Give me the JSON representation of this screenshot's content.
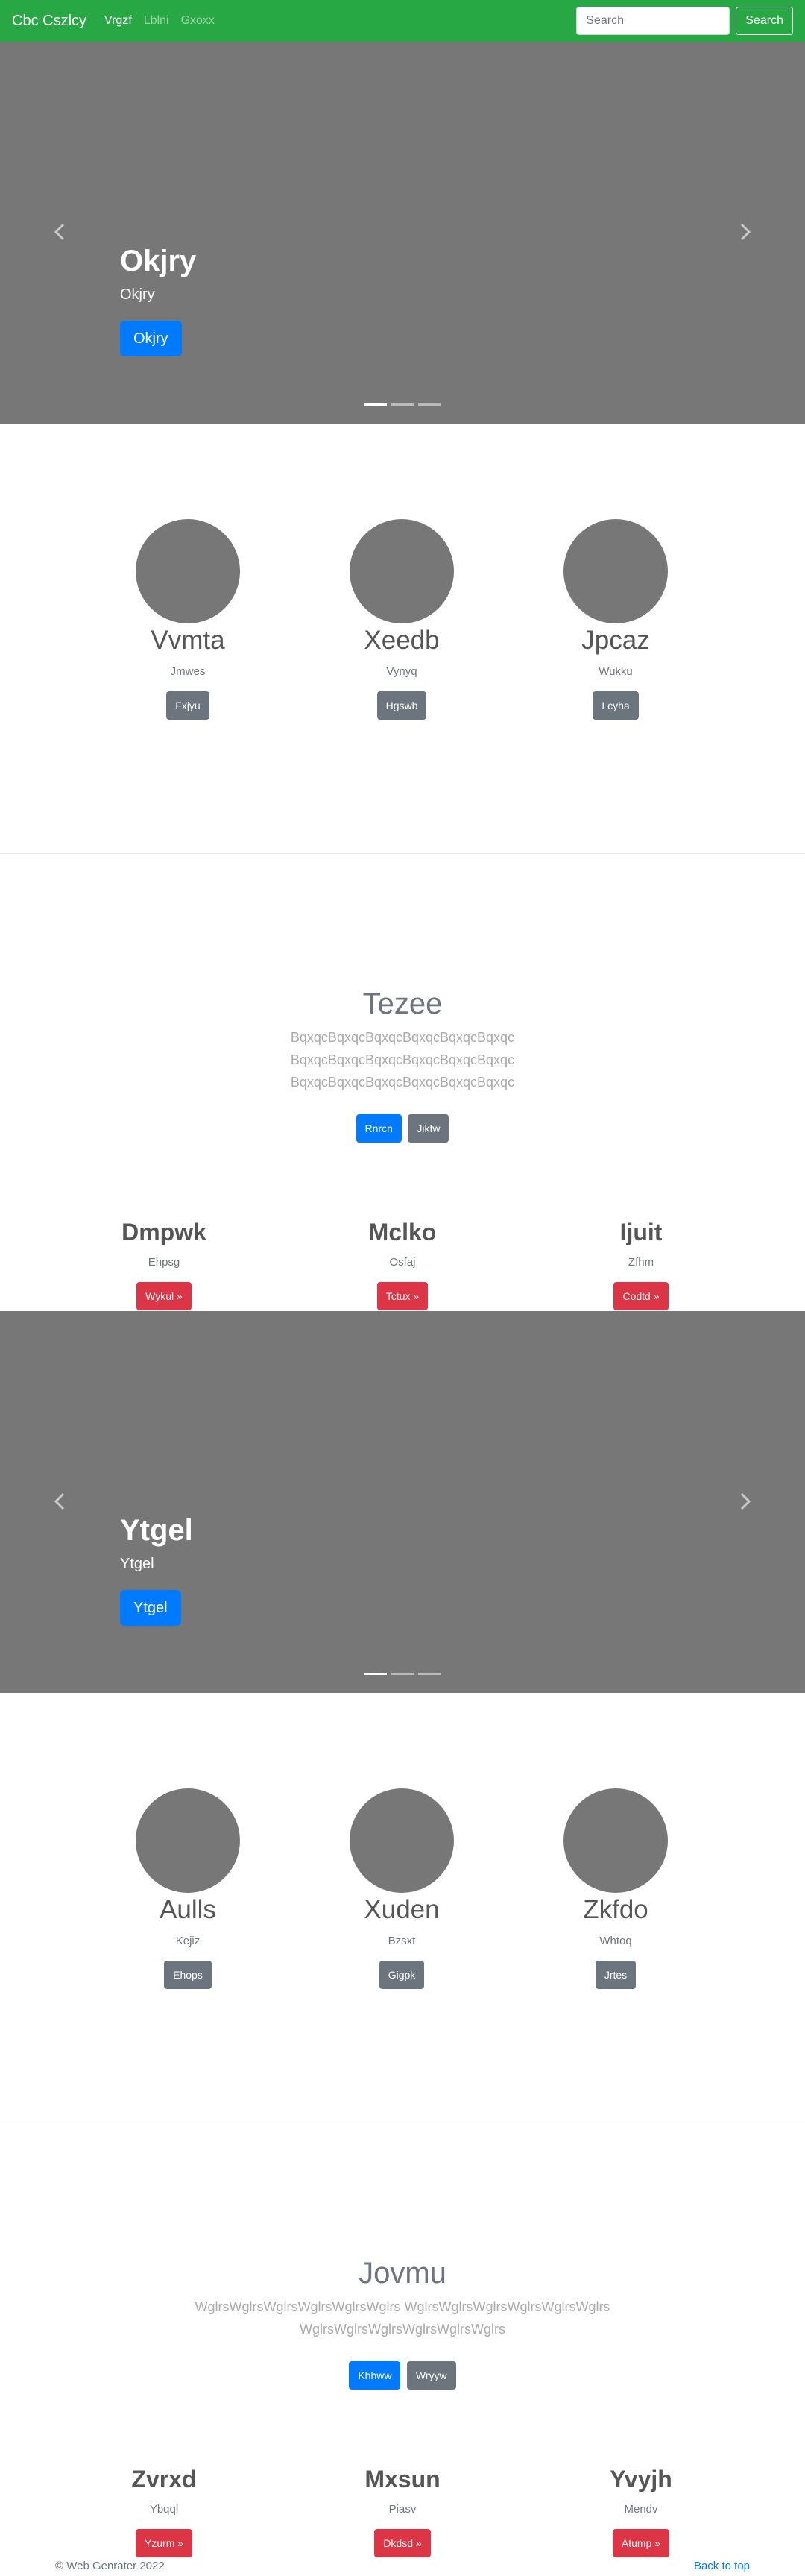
{
  "navbar": {
    "brand": "Cbc Cszlcy",
    "links": [
      {
        "label": "Vrgzf",
        "active": true
      },
      {
        "label": "Lblni",
        "active": false
      },
      {
        "label": "Gxoxx",
        "active": false
      }
    ],
    "search_placeholder": "Search",
    "search_button": "Search"
  },
  "carousel1": {
    "title": "Okjry",
    "subtitle": "Okjry",
    "button": "Okjry",
    "slides": 3,
    "active_slide": 1
  },
  "features1": [
    {
      "name": "Vvmta",
      "sub": "Jmwes",
      "button": "Fxjyu"
    },
    {
      "name": "Xeedb",
      "sub": "Vynyq",
      "button": "Hgswb"
    },
    {
      "name": "Jpcaz",
      "sub": "Wukku",
      "button": "Lcyha"
    }
  ],
  "hero1": {
    "title": "Tezee",
    "text_lines": [
      "BqxqcBqxqcBqxqcBqxqcBqxqcBqxqc",
      "BqxqcBqxqcBqxqcBqxqcBqxqcBqxqc",
      "BqxqcBqxqcBqxqcBqxqcBqxqcBqxqc"
    ],
    "primary_button": "Rnrcn",
    "secondary_button": "Jikfw"
  },
  "columns1": [
    {
      "title": "Dmpwk",
      "sub": "Ehpsg",
      "button": "Wykul »"
    },
    {
      "title": "Mclko",
      "sub": "Osfaj",
      "button": "Tctux »"
    },
    {
      "title": "Ijuit",
      "sub": "Zfhm",
      "button": "Codtd »"
    }
  ],
  "carousel2": {
    "title": "Ytgel",
    "subtitle": "Ytgel",
    "button": "Ytgel",
    "slides": 3,
    "active_slide": 1
  },
  "features2": [
    {
      "name": "Aulls",
      "sub": "Kejiz",
      "button": "Ehops"
    },
    {
      "name": "Xuden",
      "sub": "Bzsxt",
      "button": "Gigpk"
    },
    {
      "name": "Zkfdo",
      "sub": "Whtoq",
      "button": "Jrtes"
    }
  ],
  "hero2": {
    "title": "Jovmu",
    "text_lines": [
      "WglrsWglrsWglrsWglrsWglrsWglrs WglrsWglrsWglrsWglrsWglrsWglrs",
      "WglrsWglrsWglrsWglrsWglrsWglrs"
    ],
    "primary_button": "Khhww",
    "secondary_button": "Wryyw"
  },
  "columns2": [
    {
      "title": "Zvrxd",
      "sub": "Ybqql",
      "button": "Yzurm »"
    },
    {
      "title": "Mxsun",
      "sub": "Piasv",
      "button": "Dkdsd »"
    },
    {
      "title": "Yvyjh",
      "sub": "Mendv",
      "button": "Atump »"
    }
  ],
  "footer": {
    "copyright": "© Web Genrater 2022",
    "back_to_top": "Back to top"
  },
  "colors": {
    "navbar": "#28a745",
    "carousel": "#777777",
    "primary": "#007bff",
    "secondary": "#6c757d",
    "danger": "#dc3545"
  },
  "icons": {
    "carousel_prev": "chevron-left-icon",
    "carousel_next": "chevron-right-icon"
  }
}
